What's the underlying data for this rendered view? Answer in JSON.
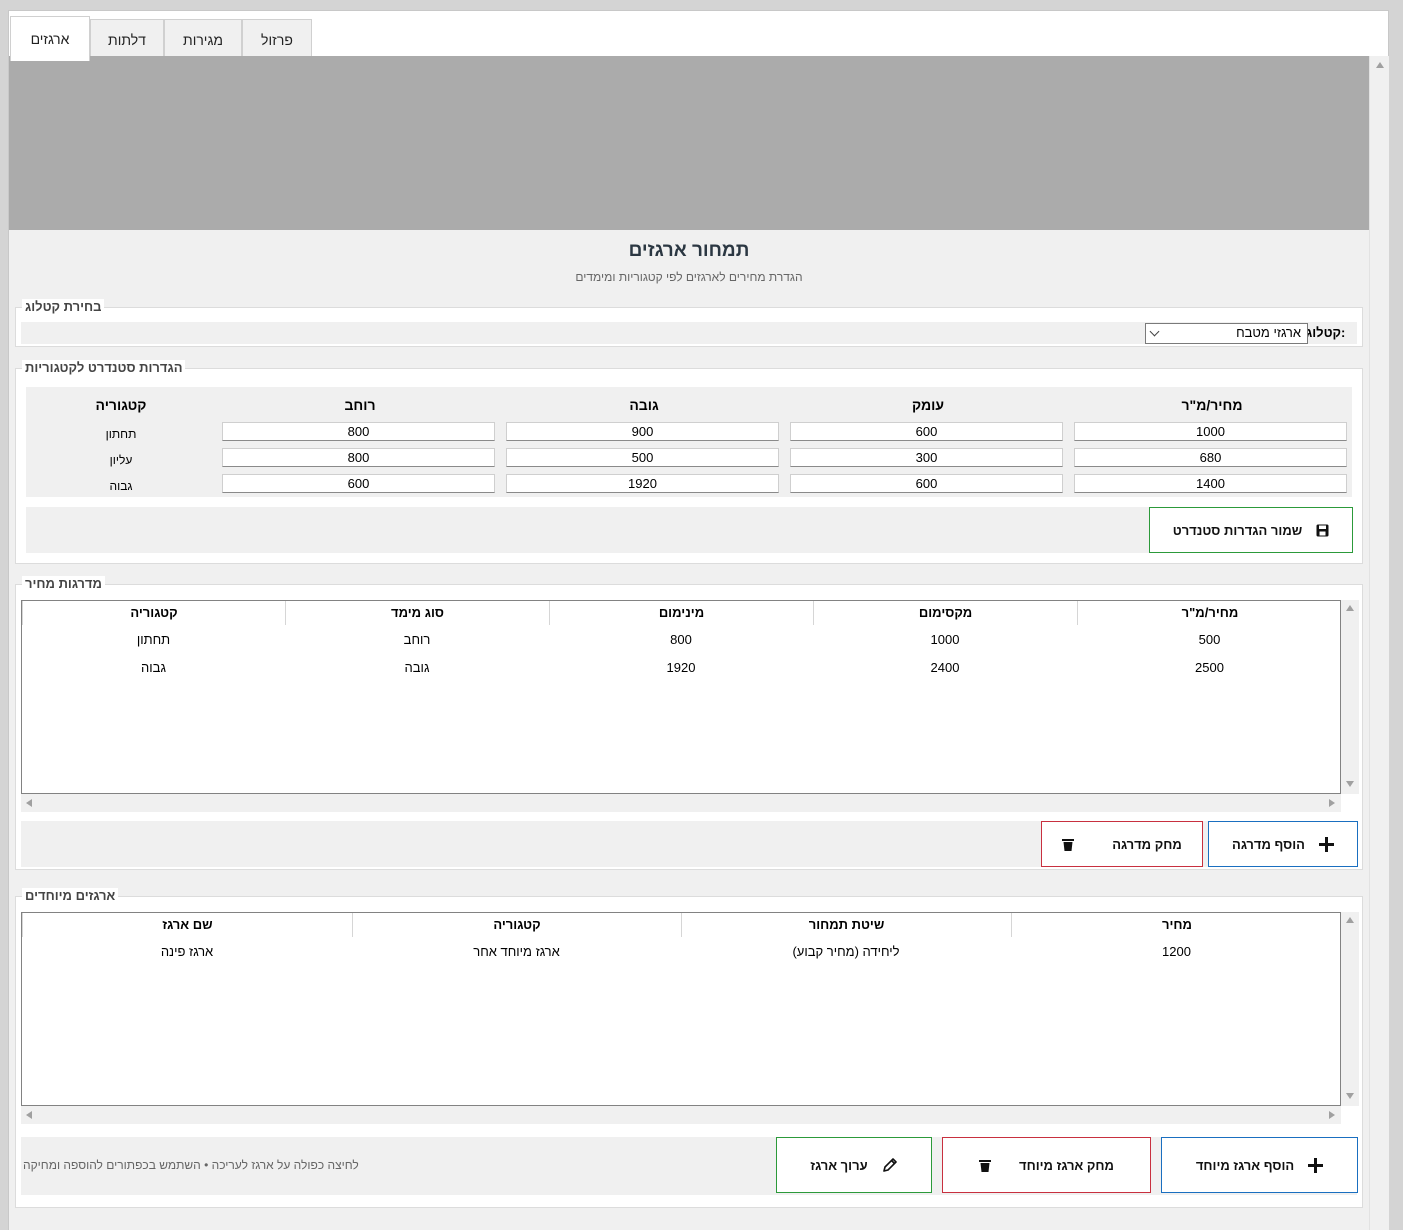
{
  "tabs": [
    {
      "label": "ארגזים",
      "active": true
    },
    {
      "label": "דלתות",
      "active": false
    },
    {
      "label": "מגירות",
      "active": false
    },
    {
      "label": "פרזול",
      "active": false
    }
  ],
  "header": {
    "title": "תמחור ארגזים",
    "subtitle": "הגדרת מחירים לארגזים לפי קטגוריות ומימדים"
  },
  "catalog": {
    "group_label": "בחירת קטלוג",
    "field_label": "קטלוג:",
    "selected": "ארגזי מטבח"
  },
  "standard": {
    "group_label": "הגדרות סטנדרט לקטגוריות",
    "headers": {
      "price": "מחיר/מ\"ר",
      "depth": "עומק",
      "height": "גובה",
      "width": "רוחב",
      "category": "קטגוריה"
    },
    "rows": [
      {
        "category": "תחתון",
        "width": "800",
        "height": "900",
        "depth": "600",
        "price": "1000"
      },
      {
        "category": "עליון",
        "width": "800",
        "height": "500",
        "depth": "300",
        "price": "680"
      },
      {
        "category": "גבוה",
        "width": "600",
        "height": "1920",
        "depth": "600",
        "price": "1400"
      }
    ],
    "save_label": "שמור הגדרות סטנדרט"
  },
  "tiers": {
    "group_label": "מדרגות מחיר",
    "headers": [
      "מחיר/מ\"ר",
      "מקסימום",
      "מינימום",
      "סוג מימד",
      "קטגוריה"
    ],
    "rows": [
      [
        "500",
        "1000",
        "800",
        "רוחב",
        "תחתון"
      ],
      [
        "2500",
        "2400",
        "1920",
        "גובה",
        "גבוה"
      ]
    ],
    "add_label": "הוסף מדרגה",
    "delete_label": "מחק מדרגה"
  },
  "special": {
    "group_label": "ארגזים מיוחדים",
    "headers": [
      "מחיר",
      "שיטת תמחור",
      "קטגוריה",
      "שם ארגז"
    ],
    "rows": [
      [
        "1200",
        "ליחידה (מחיר קבוע)",
        "ארגז מיוחד אחר",
        "ארגז פינה"
      ]
    ],
    "add_label": "הוסף ארגז מיוחד",
    "delete_label": "מחק ארגז מיוחד",
    "edit_label": "ערוך ארגז",
    "hint": "לחיצה כפולה על ארגז לעריכה • השתמש בכפתורים להוספה ומחיקה"
  },
  "colors": {
    "green": "#2c9a3a",
    "blue": "#1a6fc0",
    "red": "#c8303f",
    "banner": "#ababab"
  }
}
